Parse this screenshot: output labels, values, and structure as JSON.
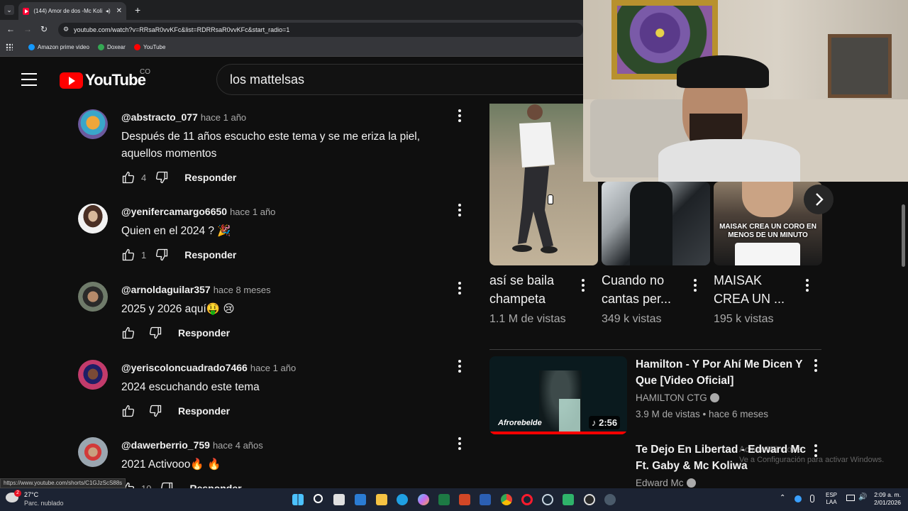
{
  "browser": {
    "tab_title": "(144) Amor de dos -Mc Koli",
    "url": "youtube.com/watch?v=RRsaR0vvKFc&list=RDRRsaR0vvKFc&start_radio=1",
    "bookmarks": [
      {
        "label": "Amazon prime video",
        "color": "#1399ff"
      },
      {
        "label": "Doxear",
        "color": "#34a853"
      },
      {
        "label": "YouTube",
        "color": "#ff0000"
      }
    ],
    "status_url": "https://www.youtube.com/shorts/C1GJzScS88s"
  },
  "youtube": {
    "logo_text": "YouTube",
    "country_code": "CO",
    "search_value": "los mattelsas"
  },
  "comments": [
    {
      "user": "@abstracto_077",
      "time": "hace 1 año",
      "text": "Después de  11 años escucho este tema  y se me eriza la piel, aquellos momentos",
      "likes": "4",
      "reply": "Responder"
    },
    {
      "user": "@yenifercamargo6650",
      "time": "hace 1 año",
      "text": "Quien en el 2024 ? 🎉",
      "likes": "1",
      "reply": "Responder"
    },
    {
      "user": "@arnoldaguilar357",
      "time": "hace 8 meses",
      "text": "2025 y 2026 aquí🤑 😢",
      "likes": "",
      "reply": "Responder"
    },
    {
      "user": "@yeriscoloncuadrado7466",
      "time": "hace 1 año",
      "text": "2024 escuchando este tema",
      "likes": "",
      "reply": "Responder"
    },
    {
      "user": "@dawerberrio_759",
      "time": "hace 4 años",
      "text": "2021 Activooo🔥 🔥",
      "likes": "10",
      "reply": "Responder"
    }
  ],
  "shorts": [
    {
      "title_line1": "así se baila",
      "title_line2": "champeta",
      "views": "1.1 M de vistas"
    },
    {
      "title_line1": "Cuando no",
      "title_line2": "cantas per...",
      "views": "349 k vistas"
    },
    {
      "title_line1": "MAISAK",
      "title_line2": "CREA UN ...",
      "views": "195 k vistas",
      "overlay_text": "MAISAK CREA UN CORO EN MENOS DE UN MINUTO"
    }
  ],
  "videos": [
    {
      "title": "Hamilton - Y Por Ahí Me Dicen Y Que [Video Oficial]",
      "channel": "HAMILTON CTG",
      "meta": "3.9 M de vistas • hace 6 meses",
      "duration": "2:56",
      "thumb_text": "Afrorebelde"
    },
    {
      "title": "Te Dejo En Libertad - Edward Mc Ft. Gaby & Mc Koliwa",
      "channel": "Edward Mc"
    }
  ],
  "watermark": {
    "line1": "Activar Windows",
    "line2": "Ve a Configuración para activar Windows."
  },
  "taskbar": {
    "weather_temp": "27°C",
    "weather_desc": "Parc. nublado",
    "notif_count": "2",
    "lang1": "ESP",
    "lang2": "LAA",
    "time": "2:09 a. m.",
    "date": "2/01/2026"
  }
}
